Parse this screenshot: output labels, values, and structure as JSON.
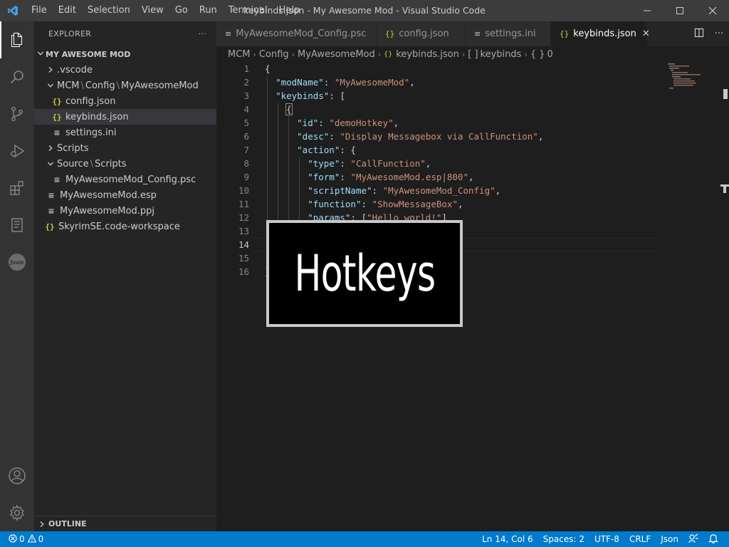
{
  "window": {
    "title": "keybinds.json - My Awesome Mod - Visual Studio Code",
    "menu": [
      "File",
      "Edit",
      "Selection",
      "View",
      "Go",
      "Run",
      "Terminal",
      "Help"
    ]
  },
  "activity_bar": {
    "icons": [
      "explorer-icon",
      "search-icon",
      "source-control-icon",
      "run-debug-icon",
      "extensions-icon",
      "notebook-icon",
      "json-icon"
    ],
    "json_label": "Json",
    "bottom_icons": [
      "account-icon",
      "settings-gear-icon"
    ]
  },
  "sidebar": {
    "header": "EXPLORER",
    "more": "···",
    "root": "MY AWESOME MOD",
    "tree": [
      {
        "label": ".vscode",
        "kind": "folder",
        "expanded": false
      },
      {
        "label_parts": [
          "MCM",
          "Config",
          "MyAwesomeMod"
        ],
        "kind": "folder",
        "expanded": true
      },
      {
        "label": "config.json",
        "kind": "json"
      },
      {
        "label": "keybinds.json",
        "kind": "json",
        "selected": true
      },
      {
        "label": "settings.ini",
        "kind": "text"
      },
      {
        "label": "Scripts",
        "kind": "folder",
        "expanded": false
      },
      {
        "label_parts": [
          "Source",
          "Scripts"
        ],
        "kind": "folder",
        "expanded": true
      },
      {
        "label": "MyAwesomeMod_Config.psc",
        "kind": "text"
      },
      {
        "label": "MyAwesomeMod.esp",
        "kind": "text"
      },
      {
        "label": "MyAwesomeMod.ppj",
        "kind": "text"
      },
      {
        "label": "SkyrimSE.code-workspace",
        "kind": "json"
      }
    ],
    "outline": "OUTLINE"
  },
  "tabs": [
    {
      "label": "MyAwesomeMod_Config.psc",
      "icon": "lines-icon",
      "active": false
    },
    {
      "label": "config.json",
      "icon": "braces-icon",
      "active": false
    },
    {
      "label": "settings.ini",
      "icon": "lines-icon",
      "active": false
    },
    {
      "label": "keybinds.json",
      "icon": "braces-icon",
      "active": true
    }
  ],
  "breadcrumbs": [
    "MCM",
    "Config",
    "MyAwesomeMod",
    "keybinds.json",
    "keybinds",
    "0"
  ],
  "editor": {
    "line_numbers": [
      "1",
      "2",
      "3",
      "4",
      "5",
      "6",
      "7",
      "8",
      "9",
      "10",
      "11",
      "12",
      "13",
      "14",
      "15",
      "16"
    ],
    "current_line": "14"
  },
  "overlay": {
    "text": "Hotkeys"
  },
  "status": {
    "errors": "0",
    "warnings": "0",
    "position": "Ln 14, Col 6",
    "spaces": "Spaces: 2",
    "encoding": "UTF-8",
    "eol": "CRLF",
    "language": "Json"
  },
  "colors": {
    "accent": "#007acc",
    "keyword": "#9cdcfe",
    "string": "#ce9178",
    "json_icon": "#cbcb41"
  }
}
